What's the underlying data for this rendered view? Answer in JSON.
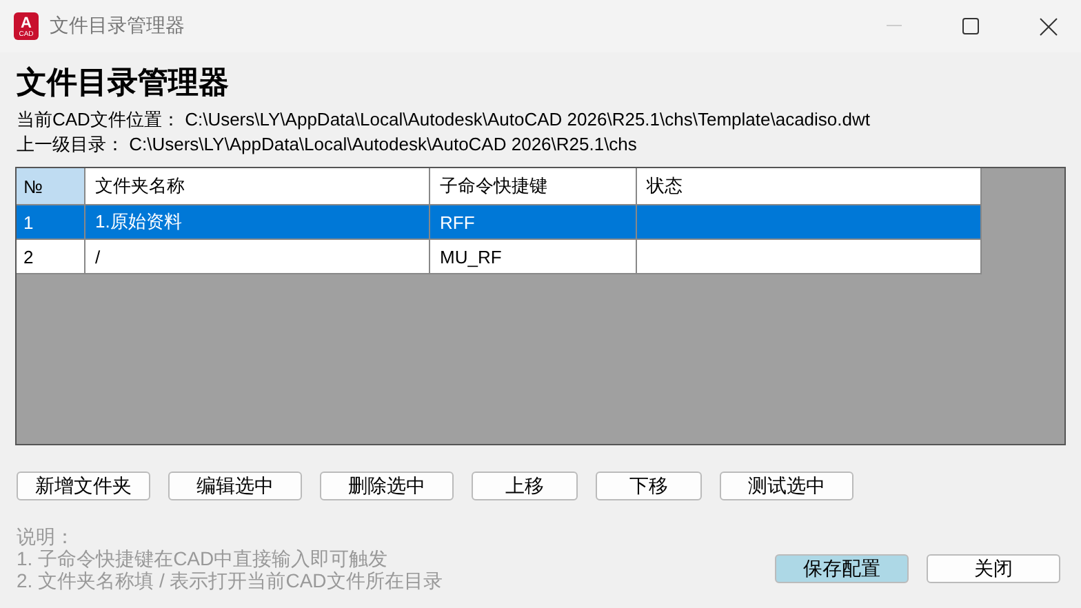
{
  "window": {
    "title": "文件目录管理器",
    "app_letter": "A",
    "app_badge": "CAD"
  },
  "heading": "文件目录管理器",
  "paths": [
    {
      "label": "当前CAD文件位置：",
      "value": "C:\\Users\\LY\\AppData\\Local\\Autodesk\\AutoCAD 2026\\R25.1\\chs\\Template\\acadiso.dwt"
    },
    {
      "label": "上一级目录：",
      "value": "C:\\Users\\LY\\AppData\\Local\\Autodesk\\AutoCAD 2026\\R25.1\\chs"
    }
  ],
  "table": {
    "columns": [
      {
        "label": "№",
        "selected": true
      },
      {
        "label": "文件夹名称",
        "selected": false
      },
      {
        "label": "子命令快捷键",
        "selected": false
      },
      {
        "label": "状态",
        "selected": false
      }
    ],
    "rows": [
      {
        "cells": [
          "1",
          "1.原始资料",
          "RFF",
          ""
        ],
        "selected": true
      },
      {
        "cells": [
          "2",
          "/",
          "MU_RF",
          ""
        ],
        "selected": false
      }
    ]
  },
  "buttons": [
    "新增文件夹",
    "编辑选中",
    "删除选中",
    "上移",
    "下移",
    "测试选中"
  ],
  "notes": {
    "title": "说明：",
    "lines": [
      "1. 子命令快捷键在CAD中直接输入即可触发",
      "2. 文件夹名称填 / 表示打开当前CAD文件所在目录"
    ]
  },
  "footer_buttons": [
    {
      "label": "保存配置",
      "primary": true
    },
    {
      "label": "关闭",
      "primary": false
    }
  ]
}
